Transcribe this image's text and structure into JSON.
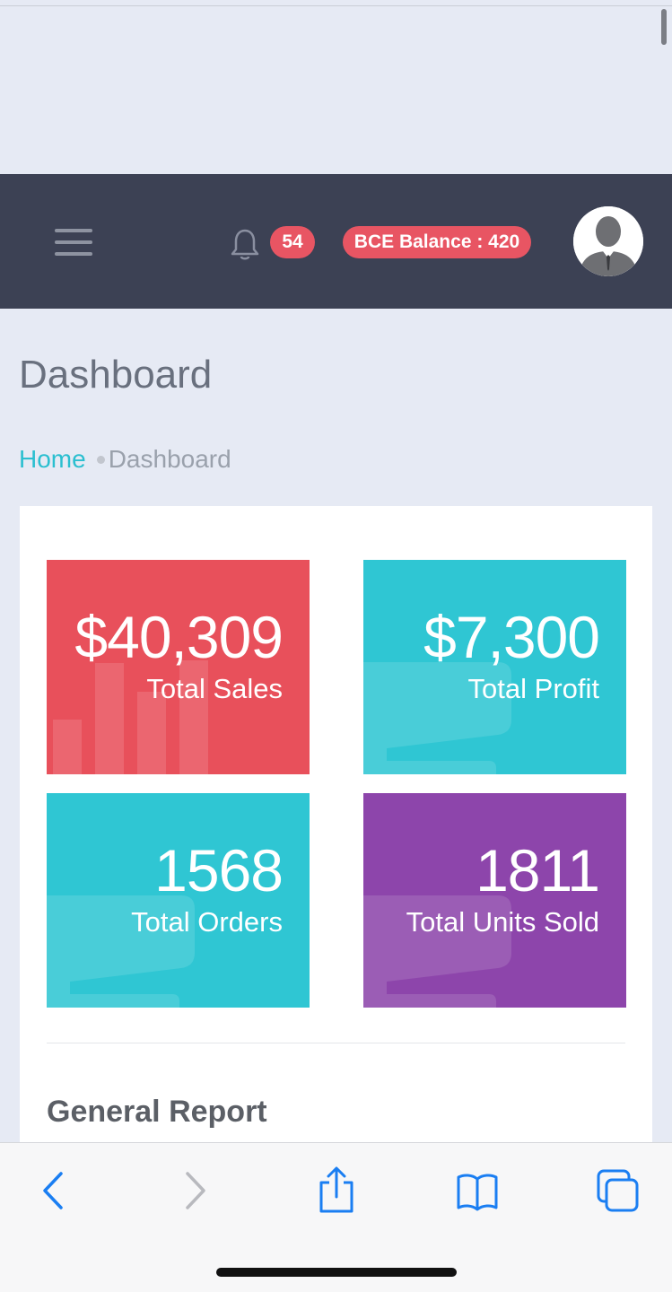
{
  "header": {
    "notification_count": "54",
    "balance_label": "BCE Balance : 420"
  },
  "page": {
    "title": "Dashboard"
  },
  "breadcrumb": {
    "home": "Home",
    "current": "Dashboard"
  },
  "stats": [
    {
      "value": "$40,309",
      "label": "Total Sales",
      "color": "#e8505b",
      "icon": "bar-chart-icon"
    },
    {
      "value": "$7,300",
      "label": "Total Profit",
      "color": "#2fc6d3",
      "icon": "cart-icon"
    },
    {
      "value": "1568",
      "label": "Total Orders",
      "color": "#2fc6d3",
      "icon": "cart-icon"
    },
    {
      "value": "1811",
      "label": "Total Units Sold",
      "color": "#8d45ab",
      "icon": "cart-icon"
    }
  ],
  "report": {
    "title": "General Report"
  },
  "colors": {
    "header_bg": "#3c4154",
    "badge": "#e85563",
    "accent": "#2bbfd0",
    "page_bg": "#e6eaf4",
    "safari_blue": "#1a7ef2"
  }
}
